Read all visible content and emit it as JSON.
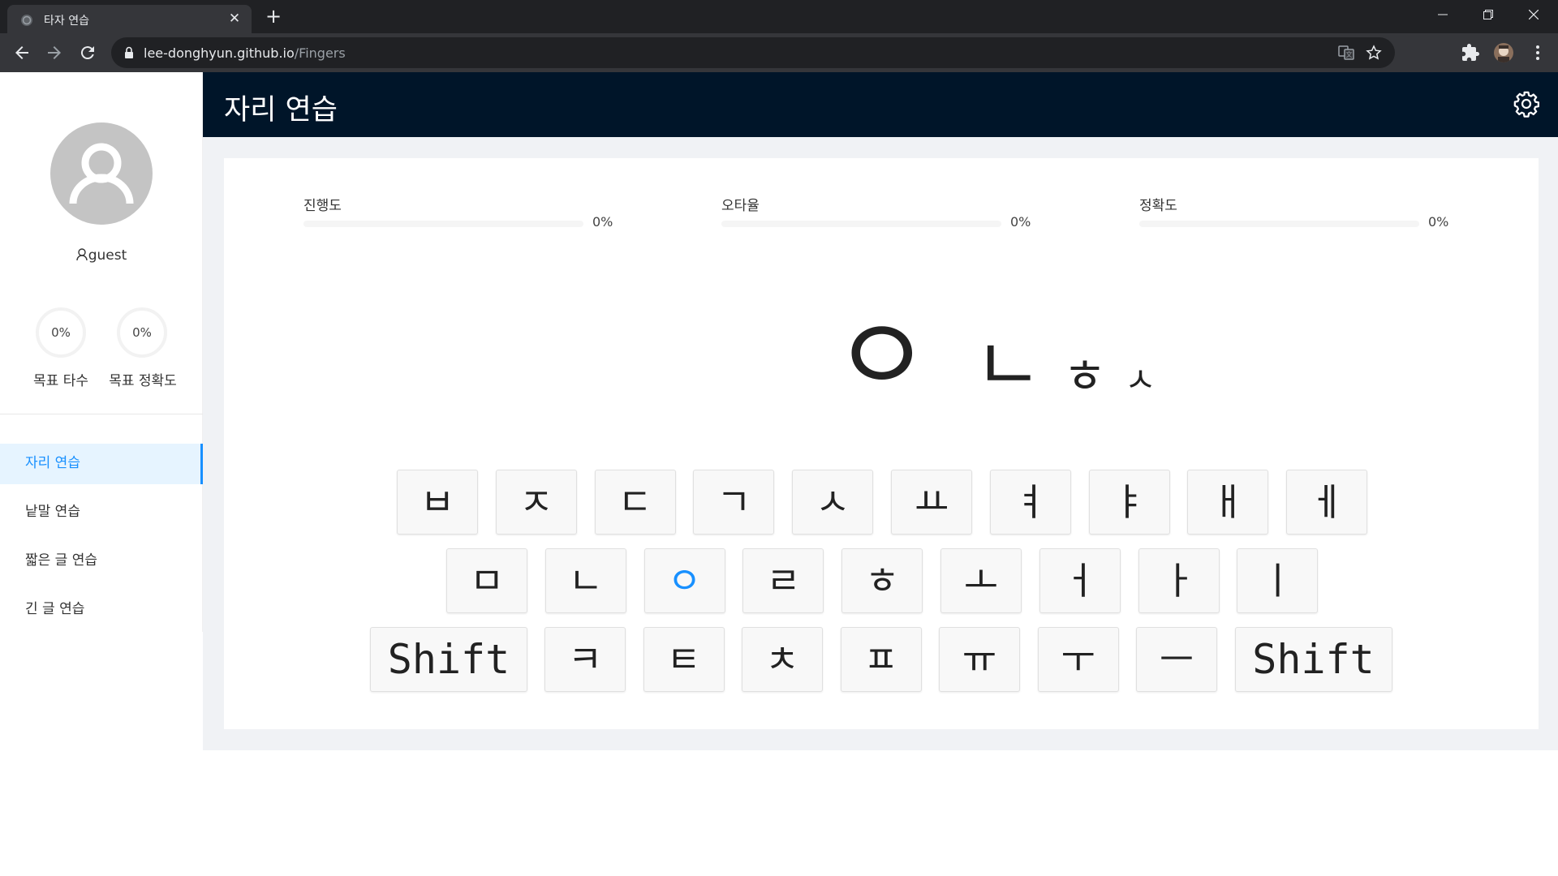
{
  "browser": {
    "tab_title": "타자 연습",
    "url_host": "lee-donghyun.github.io",
    "url_path": "/Fingers"
  },
  "sidebar": {
    "username": "guest",
    "goals": [
      {
        "value": "0%",
        "label": "목표 타수"
      },
      {
        "value": "0%",
        "label": "목표 정확도"
      }
    ],
    "menu": [
      {
        "label": "자리 연습",
        "active": true
      },
      {
        "label": "낱말 연습",
        "active": false
      },
      {
        "label": "짧은 글 연습",
        "active": false
      },
      {
        "label": "긴 글 연습",
        "active": false
      }
    ]
  },
  "header": {
    "title": "자리 연습"
  },
  "stats": [
    {
      "label": "진행도",
      "value": "0%",
      "progress": 0
    },
    {
      "label": "오타율",
      "value": "0%",
      "progress": 0
    },
    {
      "label": "정확도",
      "value": "0%",
      "progress": 0
    }
  ],
  "targets": [
    "ㅇ",
    "ㄴ",
    "ㅎ",
    "ㅅ"
  ],
  "keyboard": {
    "highlight_color": "#1890ff",
    "rows": [
      [
        "ㅂ",
        "ㅈ",
        "ㄷ",
        "ㄱ",
        "ㅅ",
        "ㅛ",
        "ㅕ",
        "ㅑ",
        "ㅐ",
        "ㅔ"
      ],
      [
        "ㅁ",
        "ㄴ",
        "ㅇ",
        "ㄹ",
        "ㅎ",
        "ㅗ",
        "ㅓ",
        "ㅏ",
        "ㅣ"
      ],
      [
        "Shift",
        "ㅋ",
        "ㅌ",
        "ㅊ",
        "ㅍ",
        "ㅠ",
        "ㅜ",
        "ㅡ",
        "Shift"
      ]
    ],
    "highlighted_key": "ㅇ"
  },
  "colors": {
    "header_bg": "#001529",
    "accent": "#1890ff",
    "content_bg": "#f0f2f5"
  }
}
